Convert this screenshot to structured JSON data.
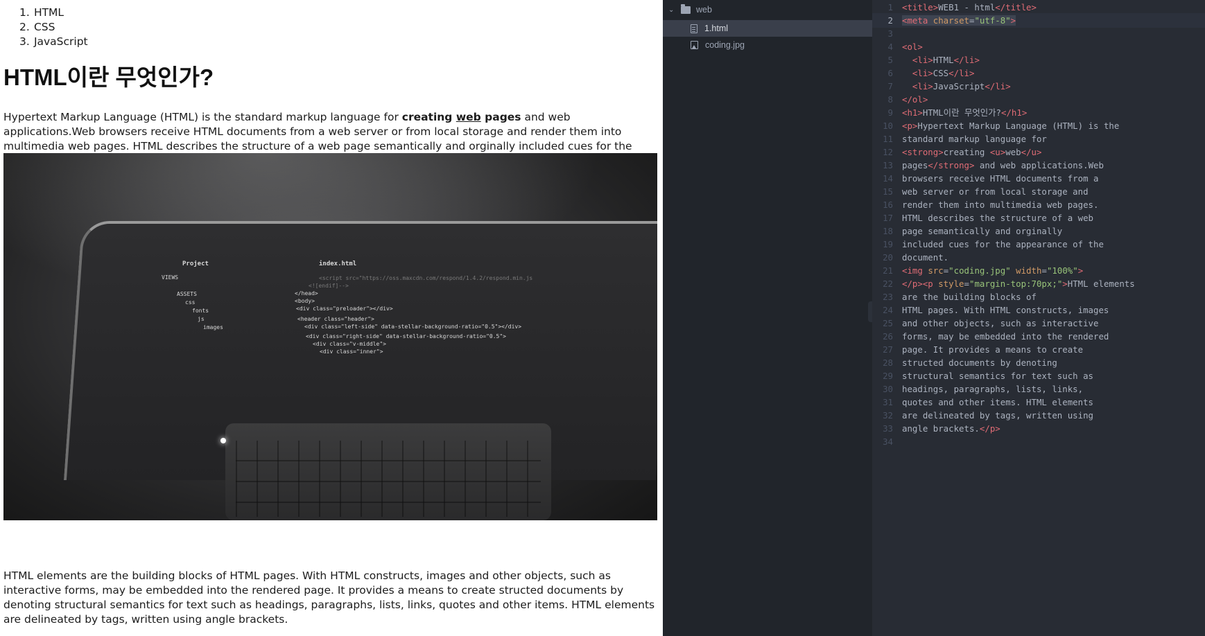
{
  "browser_page": {
    "list": [
      {
        "num": "1.",
        "text": "HTML"
      },
      {
        "num": "2.",
        "text": "CSS"
      },
      {
        "num": "3.",
        "text": "JavaScript"
      }
    ],
    "heading": "HTML이란 무엇인가?",
    "para1": {
      "before": "Hypertext Markup Language (HTML) is the standard markup language for ",
      "strong_before": "creating ",
      "underline": "web",
      "strong_after": " pages",
      "after": " and web applications.Web browsers receive HTML documents from a web server or from local storage and render them into multimedia web pages. HTML describes the structure of a web page semantically and orginally included cues for the appearance of the document."
    },
    "image": {
      "alt": "coding.jpg",
      "screen_project": "Project",
      "screen_tab": "index.html",
      "screen_code": [
        "<script src=\"https://oss.maxcdn.com/respond/1.4.2/respond.min.js",
        "<![endif]-->",
        "</head>",
        "<body>",
        "<div class=\"preloader\"></div>",
        "<header class=\"header\">",
        "<div class=\"left-side\" data-stellar-background-ratio=\"0.5\"></div>",
        "<div class=\"right-side\" data-stellar-background-ratio=\"0.5\">",
        "<div class=\"v-middle\">",
        "<div class=\"inner\">"
      ],
      "screen_tree": [
        "VIEWS",
        "ASSETS",
        "css",
        "fonts",
        "js",
        "images"
      ]
    },
    "para2": "HTML elements are the building blocks of HTML pages. With HTML constructs, images and other objects, such as interactive forms, may be embedded into the rendered page. It provides a means to create structed documents by denoting structural semantics for text such as headings, paragraphs, lists, links, quotes and other items. HTML elements are delineated by tags, written using angle brackets."
  },
  "tree_view": {
    "folder": "web",
    "files": [
      {
        "name": "1.html",
        "selected": true,
        "icon": "file-text-icon"
      },
      {
        "name": "coding.jpg",
        "selected": false,
        "icon": "image-file-icon"
      }
    ],
    "collapse_glyph": "‹"
  },
  "editor": {
    "cursor_line": 2,
    "lines": [
      [
        {
          "t": "tag",
          "s": "<title>"
        },
        {
          "t": "text",
          "s": "WEB1 - html"
        },
        {
          "t": "tag",
          "s": "</title>"
        }
      ],
      [
        {
          "t": "sel_tag",
          "s": "<meta "
        },
        {
          "t": "sel_attr",
          "s": "charset"
        },
        {
          "t": "sel_punc",
          "s": "="
        },
        {
          "t": "sel_str",
          "s": "\"utf-8\""
        },
        {
          "t": "sel_tag",
          "s": ">"
        }
      ],
      [],
      [
        {
          "t": "tag",
          "s": "<ol>"
        }
      ],
      [
        {
          "t": "text",
          "s": "  "
        },
        {
          "t": "tag",
          "s": "<li>"
        },
        {
          "t": "text",
          "s": "HTML"
        },
        {
          "t": "tag",
          "s": "</li>"
        }
      ],
      [
        {
          "t": "text",
          "s": "  "
        },
        {
          "t": "tag",
          "s": "<li>"
        },
        {
          "t": "text",
          "s": "CSS"
        },
        {
          "t": "tag",
          "s": "</li>"
        }
      ],
      [
        {
          "t": "text",
          "s": "  "
        },
        {
          "t": "tag",
          "s": "<li>"
        },
        {
          "t": "text",
          "s": "JavaScript"
        },
        {
          "t": "tag",
          "s": "</li>"
        }
      ],
      [
        {
          "t": "tag",
          "s": "</ol>"
        }
      ],
      [
        {
          "t": "tag",
          "s": "<h1>"
        },
        {
          "t": "text",
          "s": "HTML이란 무엇인가?"
        },
        {
          "t": "tag",
          "s": "</h1>"
        }
      ],
      [
        {
          "t": "tag",
          "s": "<p>"
        },
        {
          "t": "text",
          "s": "Hypertext Markup Language (HTML) is the"
        }
      ],
      [
        {
          "t": "text",
          "s": "standard markup language for"
        }
      ],
      [
        {
          "t": "tag",
          "s": "<strong>"
        },
        {
          "t": "text",
          "s": "creating "
        },
        {
          "t": "tag",
          "s": "<u>"
        },
        {
          "t": "text",
          "s": "web"
        },
        {
          "t": "tag",
          "s": "</u>"
        }
      ],
      [
        {
          "t": "text",
          "s": "pages"
        },
        {
          "t": "tag",
          "s": "</strong>"
        },
        {
          "t": "text",
          "s": " and web applications.Web"
        }
      ],
      [
        {
          "t": "text",
          "s": "browsers receive HTML documents from a"
        }
      ],
      [
        {
          "t": "text",
          "s": "web server or from local storage and"
        }
      ],
      [
        {
          "t": "text",
          "s": "render them into multimedia web pages."
        }
      ],
      [
        {
          "t": "text",
          "s": "HTML describes the structure of a web"
        }
      ],
      [
        {
          "t": "text",
          "s": "page semantically and orginally"
        }
      ],
      [
        {
          "t": "text",
          "s": "included cues for the appearance of the"
        }
      ],
      [
        {
          "t": "text",
          "s": "document."
        }
      ],
      [
        {
          "t": "tag",
          "s": "<img "
        },
        {
          "t": "attr",
          "s": "src"
        },
        {
          "t": "punc",
          "s": "="
        },
        {
          "t": "str",
          "s": "\"coding.jpg\""
        },
        {
          "t": "text",
          "s": " "
        },
        {
          "t": "attr",
          "s": "width"
        },
        {
          "t": "punc",
          "s": "="
        },
        {
          "t": "str",
          "s": "\"100%\""
        },
        {
          "t": "tag",
          "s": ">"
        }
      ],
      [
        {
          "t": "tag",
          "s": "</p><p "
        },
        {
          "t": "attr",
          "s": "style"
        },
        {
          "t": "punc",
          "s": "="
        },
        {
          "t": "str",
          "s": "\"margin-top:70px;\""
        },
        {
          "t": "tag",
          "s": ">"
        },
        {
          "t": "text",
          "s": "HTML elements"
        }
      ],
      [
        {
          "t": "text",
          "s": "are the building blocks of"
        }
      ],
      [
        {
          "t": "text",
          "s": "HTML pages. With HTML constructs, images"
        }
      ],
      [
        {
          "t": "text",
          "s": "and other objects, such as interactive"
        }
      ],
      [
        {
          "t": "text",
          "s": "forms, may be embedded into the rendered"
        }
      ],
      [
        {
          "t": "text",
          "s": "page. It provides a means to create"
        }
      ],
      [
        {
          "t": "text",
          "s": "structed documents by denoting"
        }
      ],
      [
        {
          "t": "text",
          "s": "structural semantics for text such as"
        }
      ],
      [
        {
          "t": "text",
          "s": "headings, paragraphs, lists, links,"
        }
      ],
      [
        {
          "t": "text",
          "s": "quotes and other items. HTML elements"
        }
      ],
      [
        {
          "t": "text",
          "s": "are delineated by tags, written using"
        }
      ],
      [
        {
          "t": "text",
          "s": "angle brackets."
        },
        {
          "t": "tag",
          "s": "</p>"
        }
      ],
      []
    ]
  },
  "colors": {
    "editor_bg": "#282c34",
    "tree_bg": "#21252b",
    "tag": "#e06c75",
    "attr": "#d19a66",
    "string": "#98c379",
    "text": "#abb2bf"
  }
}
